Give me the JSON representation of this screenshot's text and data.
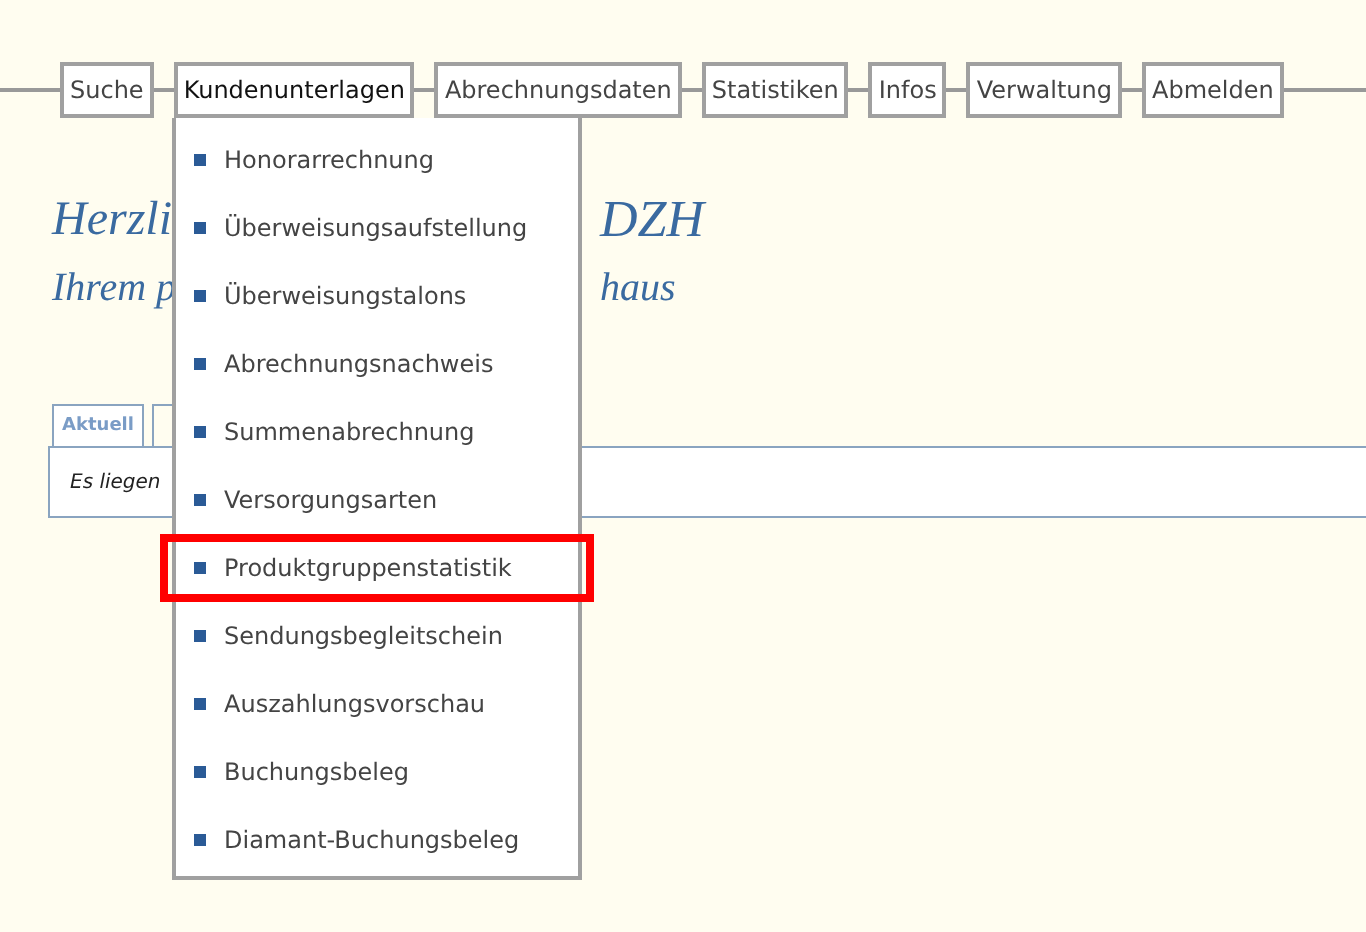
{
  "nav": [
    {
      "label": "Suche",
      "selected": false
    },
    {
      "label": "Kundenunterlagen",
      "selected": true
    },
    {
      "label": "Abrechnungsdaten",
      "selected": false
    },
    {
      "label": "Statistiken",
      "selected": false
    },
    {
      "label": "Infos",
      "selected": false
    },
    {
      "label": "Verwaltung",
      "selected": false
    },
    {
      "label": "Abmelden",
      "selected": false
    }
  ],
  "dropdown": [
    {
      "label": "Honorarrechnung",
      "highlighted": false
    },
    {
      "label": "Überweisungsaufstellung",
      "highlighted": false
    },
    {
      "label": "Überweisungstalons",
      "highlighted": false
    },
    {
      "label": "Abrechnungsnachweis",
      "highlighted": false
    },
    {
      "label": "Summenabrechnung",
      "highlighted": false
    },
    {
      "label": "Versorgungsarten",
      "highlighted": false
    },
    {
      "label": "Produktgruppenstatistik",
      "highlighted": true
    },
    {
      "label": "Sendungsbegleitschein",
      "highlighted": false
    },
    {
      "label": "Auszahlungsvorschau",
      "highlighted": false
    },
    {
      "label": "Buchungsbeleg",
      "highlighted": false
    },
    {
      "label": "Diamant-Buchungsbeleg",
      "highlighted": false
    }
  ],
  "greeting": {
    "line_1": [
      "Herzli",
      "DZH"
    ],
    "line_2": [
      "Ihrem p",
      "haus"
    ]
  },
  "tabs": [
    {
      "label": "Aktuell",
      "selected": true
    },
    {
      "selected": false
    }
  ],
  "content": {
    "text": "Es liegen"
  }
}
